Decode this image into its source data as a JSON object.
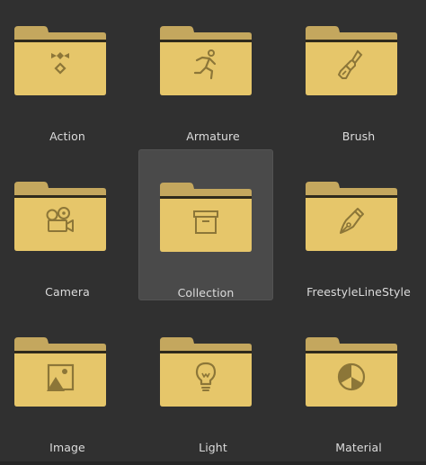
{
  "colors": {
    "background": "#303030",
    "selected_tile": "#4a4a4a",
    "folder_back": "#c4a75e",
    "folder_front": "#e6c66a",
    "folder_seam": "#2f2a1c",
    "glyph": "#8c7638",
    "label": "#dcdcdc"
  },
  "items": [
    {
      "label": "Action",
      "icon": "action-icon",
      "selected": false
    },
    {
      "label": "Armature",
      "icon": "armature-icon",
      "selected": false
    },
    {
      "label": "Brush",
      "icon": "brush-icon",
      "selected": false
    },
    {
      "label": "Camera",
      "icon": "camera-icon",
      "selected": false
    },
    {
      "label": "Collection",
      "icon": "collection-icon",
      "selected": true
    },
    {
      "label": "FreestyleLineStyle",
      "icon": "freestyle-linestyle-icon",
      "selected": false
    },
    {
      "label": "Image",
      "icon": "image-icon",
      "selected": false
    },
    {
      "label": "Light",
      "icon": "light-icon",
      "selected": false
    },
    {
      "label": "Material",
      "icon": "material-icon",
      "selected": false
    }
  ]
}
